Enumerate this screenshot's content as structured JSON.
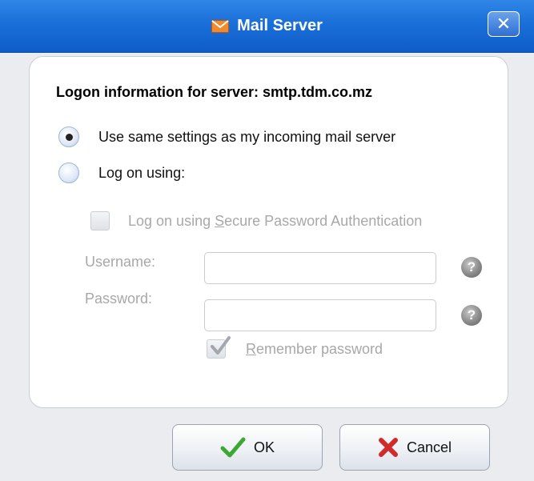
{
  "window": {
    "title": "Mail Server",
    "close_glyph": "✕",
    "icons": {
      "title": "envelope-icon",
      "close": "close-icon"
    }
  },
  "heading": "Logon information for server: smtp.tdm.co.mz",
  "options": {
    "same_settings": {
      "label": "Use same settings as my incoming mail server",
      "selected": true
    },
    "log_on_using": {
      "label": "Log on using:",
      "selected": false
    }
  },
  "spa": {
    "prefix": "Log on using ",
    "underline": "S",
    "suffix": "ecure Password Authentication",
    "checked": false,
    "enabled": false
  },
  "username": {
    "label": "Username:",
    "value": "",
    "enabled": false
  },
  "password": {
    "label": "Password:",
    "value": "",
    "enabled": false
  },
  "help_glyph": "?",
  "remember": {
    "underline": "R",
    "suffix": "emember password",
    "checked": true,
    "enabled": false
  },
  "buttons": {
    "ok": "OK",
    "cancel": "Cancel"
  },
  "colors": {
    "titlebar": "#1a6fd8",
    "ok_check": "#3aa832",
    "cancel_x": "#d22a2a",
    "disabled_text": "#a8a8a8"
  }
}
